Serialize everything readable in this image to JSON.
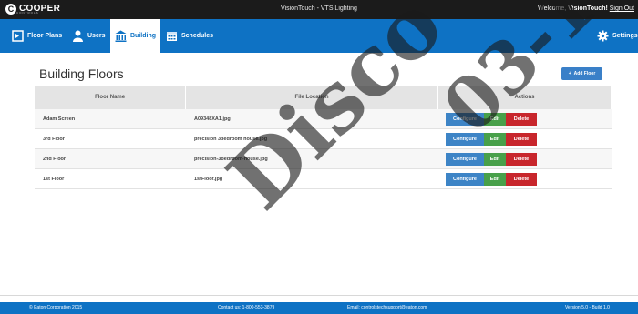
{
  "header": {
    "logo_text": "COOPER",
    "logo_sub": "CONTROLS",
    "app_title": "VisionTouch - VTS Lighting",
    "welcome_text": "Welcome, ",
    "user_name": "VisionTouch!",
    "signout_label": "Sign Out"
  },
  "nav": {
    "items": [
      {
        "label": "Floor Plans",
        "icon": "floor-plans-icon"
      },
      {
        "label": "Users",
        "icon": "user-icon"
      },
      {
        "label": "Building",
        "icon": "building-icon",
        "active": true
      },
      {
        "label": "Schedules",
        "icon": "calendar-icon"
      }
    ],
    "settings_label": "Settings",
    "settings_icon": "gear-icon"
  },
  "main": {
    "title": "Building Floors",
    "add_button_label": "Add Floor"
  },
  "table": {
    "columns": [
      "Floor Name",
      "File Location",
      "Actions"
    ],
    "rows": [
      {
        "name": "Adam Screen",
        "file": "A09348XA1.jpg"
      },
      {
        "name": "3rd Floor",
        "file": "precision 3bedroom house.jpg"
      },
      {
        "name": "2nd Floor",
        "file": "precision-3bedroom-house.jpg"
      },
      {
        "name": "1st Floor",
        "file": "1stFloor.jpg"
      }
    ],
    "action_labels": {
      "configure": "Configure",
      "edit": "Edit",
      "delete": "Delete"
    }
  },
  "footer": {
    "copyright": "© Eaton Corporation 2015",
    "contact": "Contact us: 1-800-553-3879",
    "email": "Email: controlstechsupport@eaton.com",
    "version": "Version 5.0 - Build 1.0"
  },
  "watermark": {
    "line1": "Disco",
    "line2": "03-1"
  },
  "colors": {
    "nav": "#0e72c4",
    "topbar": "#1b1b1b",
    "configure": "#3d84c6",
    "edit": "#48a04a",
    "delete": "#c8262c"
  }
}
